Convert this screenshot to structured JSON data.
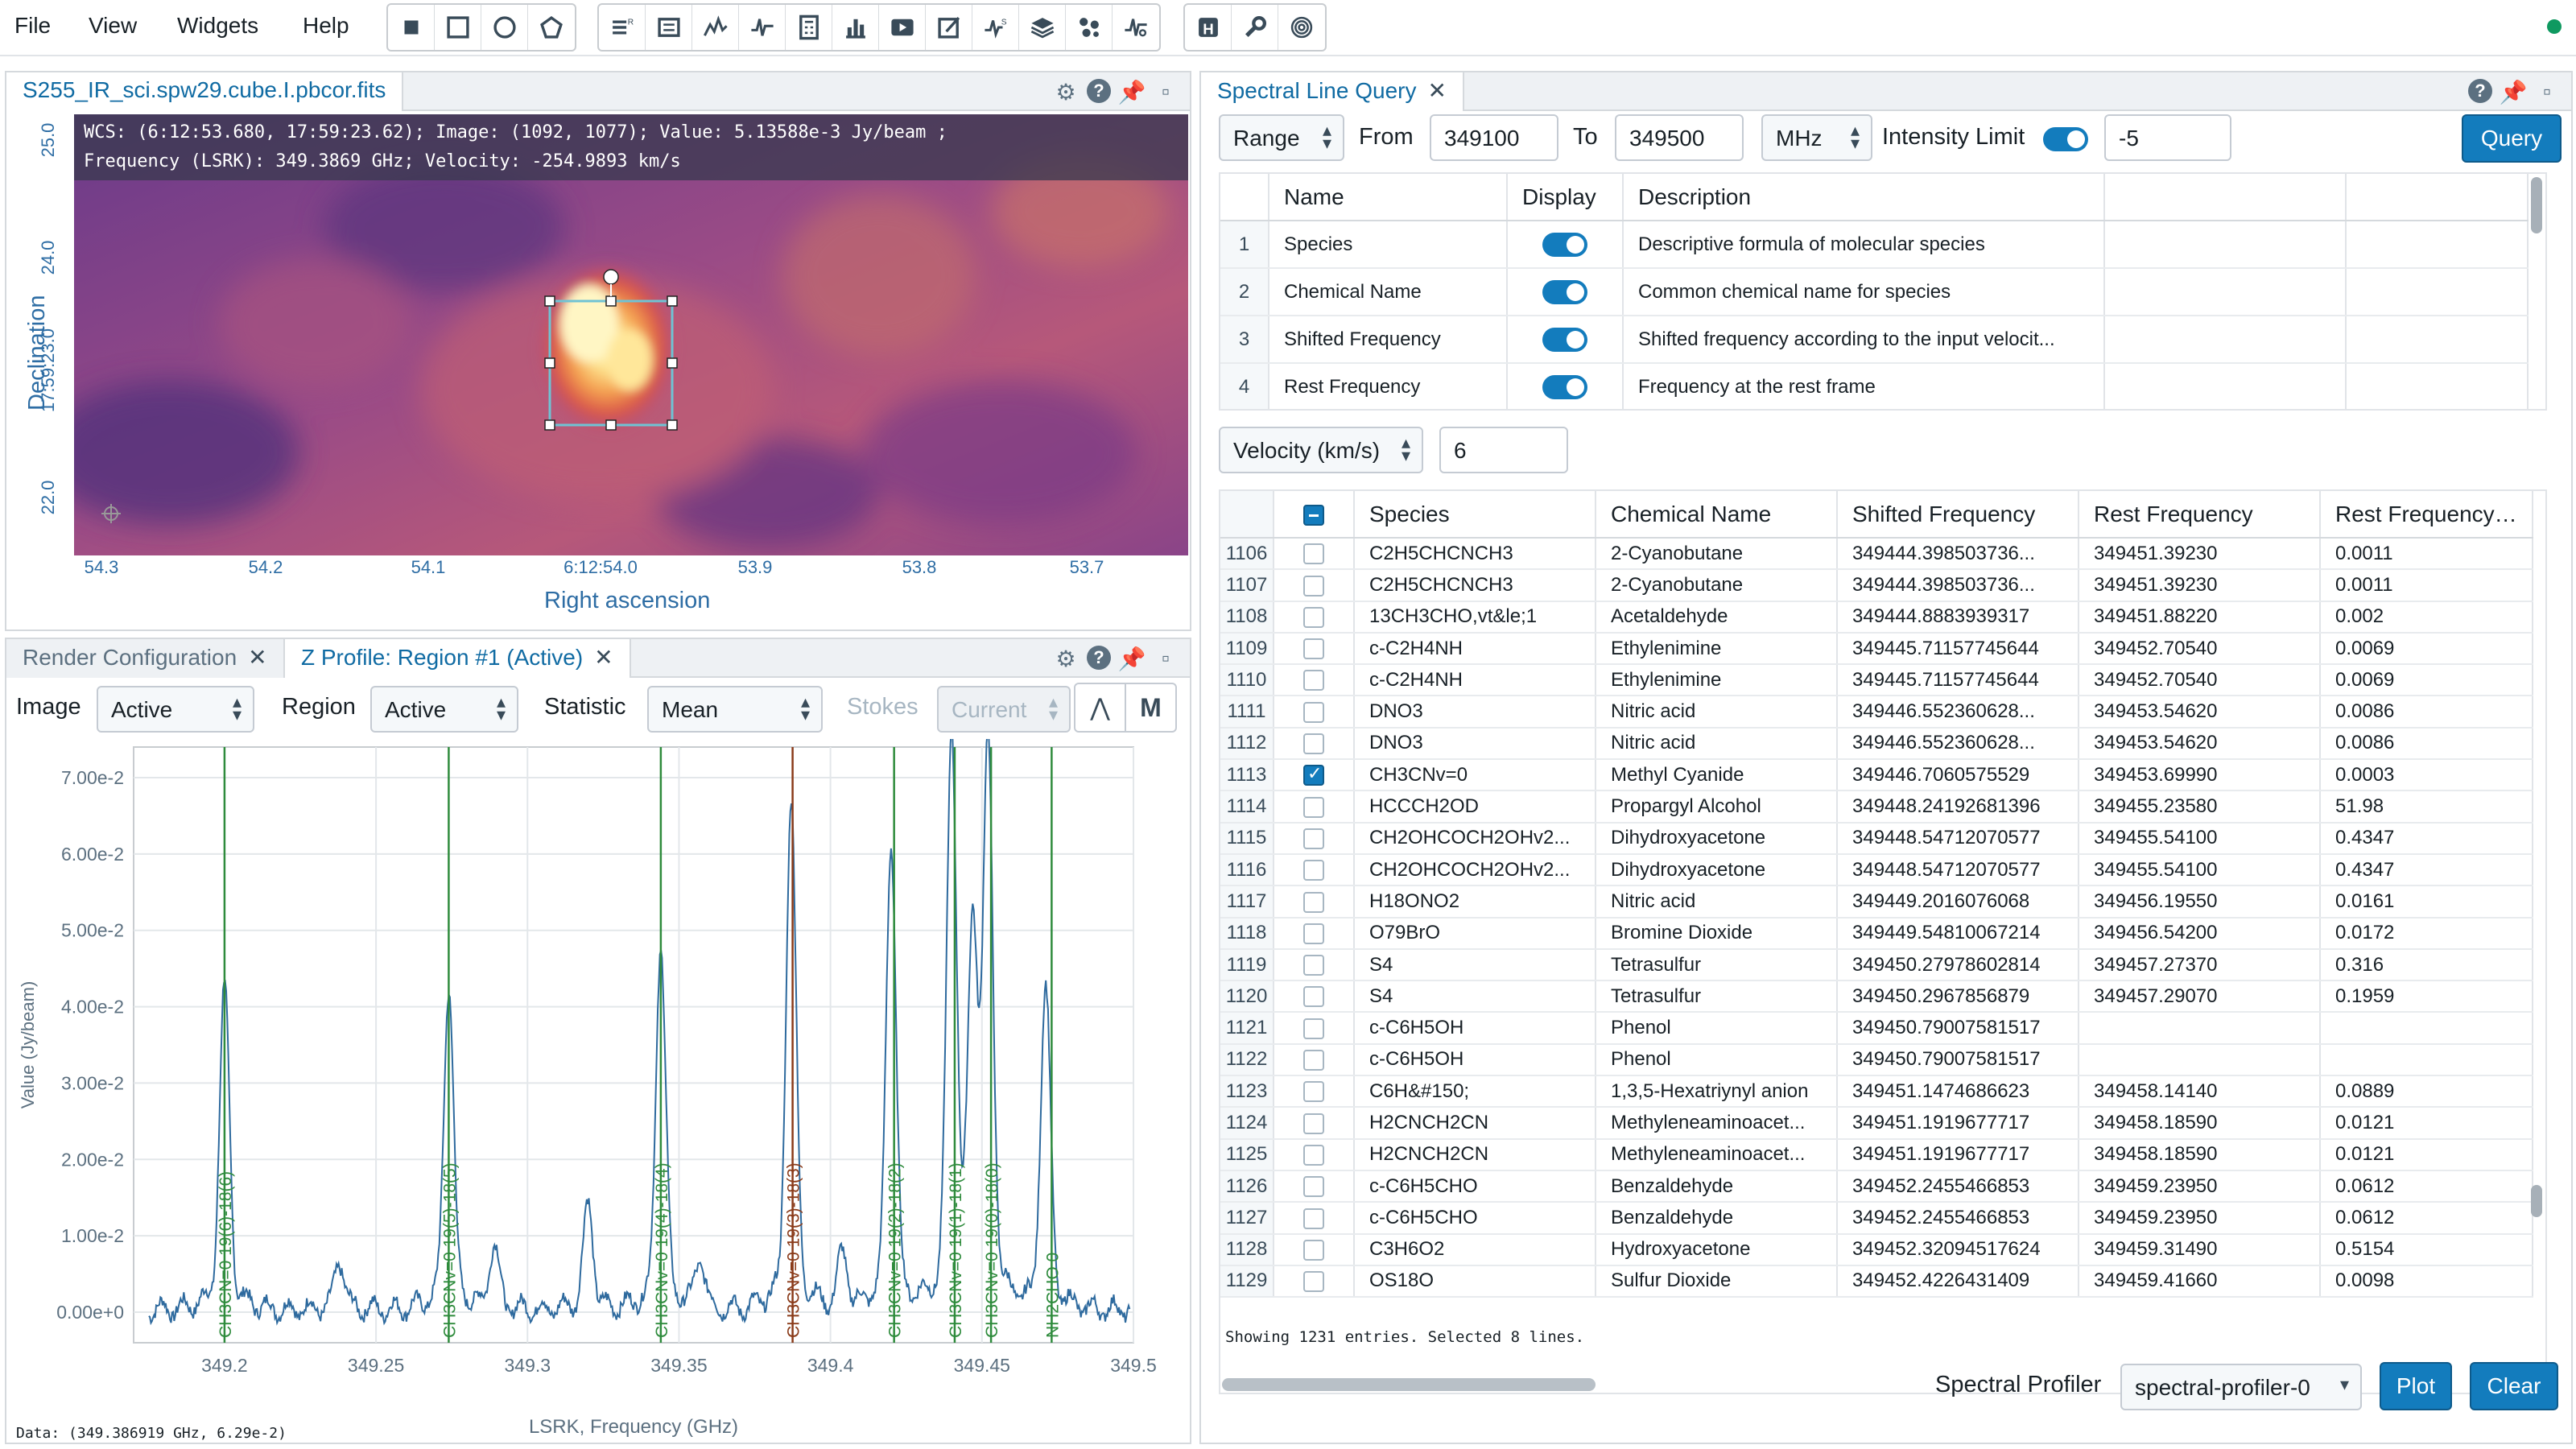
{
  "menu": {
    "file": "File",
    "view": "View",
    "widgets": "Widgets",
    "help": "Help"
  },
  "toolbar": {
    "region_tools": [
      "point-tool-icon",
      "rectangle-tool-icon",
      "ellipse-tool-icon",
      "polygon-tool-icon"
    ],
    "widget_tools": [
      "region-list-icon",
      "image-list-icon",
      "xy-profile-icon",
      "z-profile-icon",
      "statistics-icon",
      "histogram-icon",
      "animator-icon",
      "render-config-icon",
      "stokes-icon",
      "layer-list-icon",
      "catalog-icon",
      "spectral-line-icon"
    ],
    "misc_tools": [
      "header-icon",
      "preferences-icon",
      "contour-icon"
    ]
  },
  "image_panel": {
    "tab_title": "S255_IR_sci.spw29.cube.I.pbcor.fits",
    "cursor_info_line1": "WCS: (6:12:53.680, 17:59:23.62); Image: (1092, 1077); Value:  5.13588e-3 Jy/beam ;",
    "cursor_info_line2": "Frequency (LSRK): 349.3869 GHz; Velocity: -254.9893 km/s",
    "y_axis_label": "Declination",
    "x_axis_label": "Right ascension",
    "y_ticks": [
      "25.0",
      "24.0",
      "17:59:23.0",
      "22.0"
    ],
    "x_ticks": [
      "54.3",
      "54.2",
      "54.1",
      "6:12:54.0",
      "53.9",
      "53.8",
      "53.7"
    ]
  },
  "bottom_left": {
    "tabs": [
      "Render Configuration",
      "Z Profile: Region #1 (Active)"
    ],
    "image_label": "Image",
    "image_value": "Active",
    "region_label": "Region",
    "region_value": "Active",
    "statistic_label": "Statistic",
    "statistic_value": "Mean",
    "stokes_label": "Stokes",
    "stokes_value": "Current",
    "data_readout": "Data: (349.386919 GHz, 6.29e-2)"
  },
  "chart_data": {
    "type": "line",
    "xlabel": "LSRK, Frequency (GHz)",
    "ylabel": "Value (Jy/beam)",
    "xlim": [
      349.17,
      349.5
    ],
    "ylim": [
      -0.004,
      0.074
    ],
    "x_ticks": [
      "349.2",
      "349.25",
      "349.3",
      "349.35",
      "349.4",
      "349.45",
      "349.5"
    ],
    "x_tick_values": [
      349.2,
      349.25,
      349.3,
      349.35,
      349.4,
      349.45,
      349.5
    ],
    "y_ticks": [
      "7.00e-2",
      "6.00e-2",
      "5.00e-2",
      "4.00e-2",
      "3.00e-2",
      "2.00e-2",
      "1.00e-2",
      "0.00e+0"
    ],
    "y_tick_values": [
      0.07,
      0.06,
      0.05,
      0.04,
      0.03,
      0.02,
      0.01,
      0.0
    ],
    "grid": true,
    "cursor_x": 349.387,
    "peaks": [
      {
        "x": 349.2,
        "y": 0.04
      },
      {
        "x": 349.274,
        "y": 0.04
      },
      {
        "x": 349.344,
        "y": 0.045
      },
      {
        "x": 349.387,
        "y": 0.063
      },
      {
        "x": 349.42,
        "y": 0.058
      },
      {
        "x": 349.44,
        "y": 0.07
      },
      {
        "x": 349.452,
        "y": 0.068
      },
      {
        "x": 349.471,
        "y": 0.04
      },
      {
        "x": 349.32,
        "y": 0.013
      },
      {
        "x": 349.238,
        "y": 0.006
      },
      {
        "x": 349.289,
        "y": 0.008
      },
      {
        "x": 349.357,
        "y": 0.006
      },
      {
        "x": 349.404,
        "y": 0.007
      },
      {
        "x": 349.447,
        "y": 0.045
      }
    ],
    "line_markers": [
      {
        "x": 349.2,
        "label": "CH3CN=0 19(6)-18(6)",
        "color": "#2e8b3c"
      },
      {
        "x": 349.274,
        "label": "CH3CNv=0 19(5)-18(5)",
        "color": "#2e8b3c"
      },
      {
        "x": 349.344,
        "label": "CH3CNv=0 19(4)-18(4)",
        "color": "#2e8b3c"
      },
      {
        "x": 349.3875,
        "label": "CH3CNv=0 19(3)-18(3)",
        "color": "#8a3b1a"
      },
      {
        "x": 349.421,
        "label": "CH3CNv=0 19(2)-18(2)",
        "color": "#2e8b3c"
      },
      {
        "x": 349.441,
        "label": "CH3CNv=0 19(1)-18(1)",
        "color": "#2e8b3c"
      },
      {
        "x": 349.453,
        "label": "CH3CNv=0 19(0)-18(0)",
        "color": "#2e8b3c"
      },
      {
        "x": 349.473,
        "label": "NH2CHO 0",
        "color": "#2e8b3c"
      }
    ],
    "series_color": "#2e6a9e"
  },
  "spectral_query": {
    "tab_title": "Spectral Line Query",
    "range_mode": "Range",
    "from_label": "From",
    "from_value": "349100",
    "to_label": "To",
    "to_value": "349500",
    "unit": "MHz",
    "intensity_label": "Intensity Limit",
    "intensity_value": "-5",
    "query_button": "Query",
    "header_cols": [
      "Name",
      "Display",
      "Description"
    ],
    "header_rows": [
      {
        "n": "1",
        "name": "Species",
        "desc": "Descriptive formula of molecular species"
      },
      {
        "n": "2",
        "name": "Chemical Name",
        "desc": "Common chemical name for species"
      },
      {
        "n": "3",
        "name": "Shifted Frequency",
        "desc": "Shifted frequency according to the input velocit..."
      },
      {
        "n": "4",
        "name": "Rest Frequency",
        "desc": "Frequency at the rest frame"
      }
    ],
    "velocity_label": "Velocity (km/s)",
    "velocity_value": "6",
    "result_cols": [
      "Species",
      "Chemical Name",
      "Shifted Frequency",
      "Rest Frequency",
      "Rest Frequency Er"
    ],
    "rows": [
      {
        "n": "1106",
        "s": "C2H5CHCNCH3",
        "c": "2-Cyanobutane",
        "f": "349444.398503736...",
        "r": "349451.39230",
        "e": "0.0011",
        "sel": false
      },
      {
        "n": "1107",
        "s": "C2H5CHCNCH3",
        "c": "2-Cyanobutane",
        "f": "349444.398503736...",
        "r": "349451.39230",
        "e": "0.0011",
        "sel": false
      },
      {
        "n": "1108",
        "s": "13CH3CHO,vt&le;1",
        "c": "Acetaldehyde",
        "f": "349444.8883939317",
        "r": "349451.88220",
        "e": "0.002",
        "sel": false
      },
      {
        "n": "1109",
        "s": "c-C2H4NH",
        "c": "Ethylenimine",
        "f": "349445.71157745644",
        "r": "349452.70540",
        "e": "0.0069",
        "sel": false
      },
      {
        "n": "1110",
        "s": "c-C2H4NH",
        "c": "Ethylenimine",
        "f": "349445.71157745644",
        "r": "349452.70540",
        "e": "0.0069",
        "sel": false
      },
      {
        "n": "1111",
        "s": "DNO3",
        "c": "Nitric acid",
        "f": "349446.552360628...",
        "r": "349453.54620",
        "e": "0.0086",
        "sel": false
      },
      {
        "n": "1112",
        "s": "DNO3",
        "c": "Nitric acid",
        "f": "349446.552360628...",
        "r": "349453.54620",
        "e": "0.0086",
        "sel": false
      },
      {
        "n": "1113",
        "s": "CH3CNv=0",
        "c": "Methyl Cyanide",
        "f": "349446.7060575529",
        "r": "349453.69990",
        "e": "0.0003",
        "sel": true
      },
      {
        "n": "1114",
        "s": "HCCCH2OD",
        "c": "Propargyl Alcohol",
        "f": "349448.24192681396",
        "r": "349455.23580",
        "e": "51.98",
        "sel": false
      },
      {
        "n": "1115",
        "s": "CH2OHCOCH2OHv2...",
        "c": "Dihydroxyacetone",
        "f": "349448.54712070577",
        "r": "349455.54100",
        "e": "0.4347",
        "sel": false
      },
      {
        "n": "1116",
        "s": "CH2OHCOCH2OHv2...",
        "c": "Dihydroxyacetone",
        "f": "349448.54712070577",
        "r": "349455.54100",
        "e": "0.4347",
        "sel": false
      },
      {
        "n": "1117",
        "s": "H18ONO2",
        "c": "Nitric acid",
        "f": "349449.2016076068",
        "r": "349456.19550",
        "e": "0.0161",
        "sel": false
      },
      {
        "n": "1118",
        "s": "O79BrO",
        "c": "Bromine Dioxide",
        "f": "349449.54810067214",
        "r": "349456.54200",
        "e": "0.0172",
        "sel": false
      },
      {
        "n": "1119",
        "s": "S4",
        "c": "Tetrasulfur",
        "f": "349450.27978602814",
        "r": "349457.27370",
        "e": "0.316",
        "sel": false
      },
      {
        "n": "1120",
        "s": "S4",
        "c": "Tetrasulfur",
        "f": "349450.2967856879",
        "r": "349457.29070",
        "e": "0.1959",
        "sel": false
      },
      {
        "n": "1121",
        "s": "c-C6H5OH",
        "c": "Phenol",
        "f": "349450.79007581517",
        "r": "",
        "e": "",
        "sel": false
      },
      {
        "n": "1122",
        "s": "c-C6H5OH",
        "c": "Phenol",
        "f": "349450.79007581517",
        "r": "",
        "e": "",
        "sel": false
      },
      {
        "n": "1123",
        "s": "C6H&#150;",
        "c": "1,3,5-Hexatriynyl anion",
        "f": "349451.1474686623",
        "r": "349458.14140",
        "e": "0.0889",
        "sel": false
      },
      {
        "n": "1124",
        "s": "H2CNCH2CN",
        "c": "Methyleneaminoacet...",
        "f": "349451.1919677717",
        "r": "349458.18590",
        "e": "0.0121",
        "sel": false
      },
      {
        "n": "1125",
        "s": "H2CNCH2CN",
        "c": "Methyleneaminoacet...",
        "f": "349451.1919677717",
        "r": "349458.18590",
        "e": "0.0121",
        "sel": false
      },
      {
        "n": "1126",
        "s": "c-C6H5CHO",
        "c": "Benzaldehyde",
        "f": "349452.2455466853",
        "r": "349459.23950",
        "e": "0.0612",
        "sel": false
      },
      {
        "n": "1127",
        "s": "c-C6H5CHO",
        "c": "Benzaldehyde",
        "f": "349452.2455466853",
        "r": "349459.23950",
        "e": "0.0612",
        "sel": false
      },
      {
        "n": "1128",
        "s": "C3H6O2",
        "c": "Hydroxyacetone",
        "f": "349452.32094517624",
        "r": "349459.31490",
        "e": "0.5154",
        "sel": false
      },
      {
        "n": "1129",
        "s": "OS18O",
        "c": "Sulfur Dioxide",
        "f": "349452.4226431409",
        "r": "349459.41660",
        "e": "0.0098",
        "sel": false
      }
    ],
    "footer_info": "Showing 1231 entries. Selected 8 lines.",
    "profiler_label": "Spectral Profiler",
    "profiler_value": "spectral-profiler-0",
    "plot_button": "Plot",
    "clear_button": "Clear"
  },
  "colors": {
    "accent": "#137cbd",
    "plot_line": "#2e6a9e",
    "marker_green": "#2e8b3c",
    "marker_red": "#8a3b1a"
  }
}
